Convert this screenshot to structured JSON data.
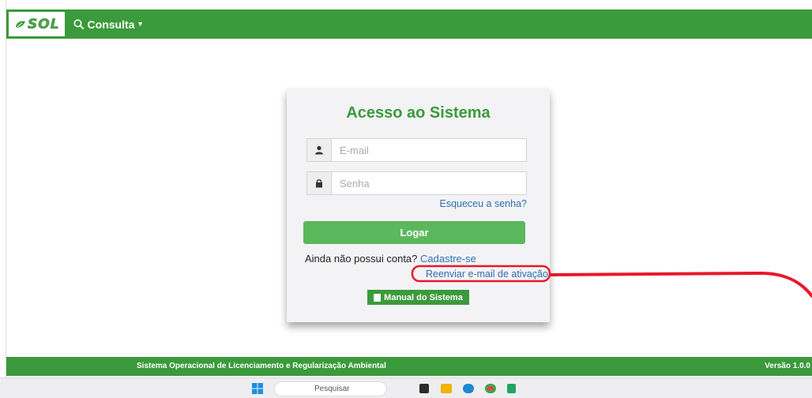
{
  "app": {
    "brand": "SOL",
    "menu_consulta": "Consulta"
  },
  "login": {
    "title": "Acesso ao Sistema",
    "email_placeholder": "E-mail",
    "password_placeholder": "Senha",
    "forgot_password": "Esqueceu a senha?",
    "submit_label": "Logar",
    "no_account_text": "Ainda não possui conta?",
    "signup_link": "Cadastre-se",
    "resend_activation": "Reenviar e-mail de ativação",
    "manual_button": "Manual do Sistema"
  },
  "footer": {
    "system_name": "Sistema Operacional de Licenciamento e Regularização Ambiental",
    "version": "Versão 1.0.0"
  },
  "taskbar": {
    "search_placeholder": "Pesquisar"
  },
  "colors": {
    "brand_green": "#3b9a3b",
    "button_green": "#5cb85c",
    "link_blue": "#2f6fb0",
    "annotation_red": "#e8182a"
  }
}
